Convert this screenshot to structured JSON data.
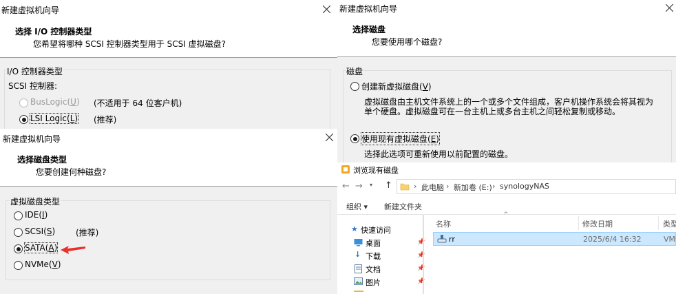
{
  "dialog_io": {
    "window_title": "新建虚拟机向导",
    "heading": "选择 I/O 控制器类型",
    "subheading": "您希望将哪种 SCSI 控制器类型用于 SCSI 虚拟磁盘?",
    "group_label": "I/O 控制器类型",
    "scsi_label": "SCSI 控制器:",
    "options": [
      {
        "label_pre": "BusLogic(",
        "key": "U",
        "label_post": ")",
        "note": "(不适用于 64 位客户机)",
        "checked": false,
        "disabled": true
      },
      {
        "label_pre": "LSI Logic(",
        "key": "L",
        "label_post": ")",
        "note": "(推荐)",
        "checked": true,
        "disabled": false
      }
    ]
  },
  "dialog_disk_type": {
    "window_title": "新建虚拟机向导",
    "heading": "选择磁盘类型",
    "subheading": "您要创建何种磁盘?",
    "group_label": "虚拟磁盘类型",
    "options": [
      {
        "label_pre": "IDE(",
        "key": "I",
        "label_post": ")",
        "note": "",
        "checked": false
      },
      {
        "label_pre": "SCSI(",
        "key": "S",
        "label_post": ")",
        "note": "(推荐)",
        "checked": false
      },
      {
        "label_pre": "SATA(",
        "key": "A",
        "label_post": ")",
        "note": "",
        "checked": true
      },
      {
        "label_pre": "NVMe(",
        "key": "V",
        "label_post": ")",
        "note": "",
        "checked": false
      }
    ],
    "arrow_color": "#e8302c"
  },
  "dialog_disk": {
    "window_title": "新建虚拟机向导",
    "heading": "选择磁盘",
    "subheading": "您要使用哪个磁盘?",
    "group_label": "磁盘",
    "opt_create": {
      "label_pre": "创建新虚拟磁盘(",
      "key": "V",
      "label_post": ")",
      "checked": false
    },
    "create_desc_1": "虚拟磁盘由主机文件系统上的一个或多个文件组成，客户机操作系统会将其视为",
    "create_desc_2": "单个硬盘。虚拟磁盘可在一台主机上或多台主机之间轻松复制或移动。",
    "opt_existing": {
      "label_pre": "使用现有虚拟磁盘(",
      "key": "E",
      "label_post": ")",
      "checked": true
    },
    "existing_desc": "选择此选项可重新使用以前配置的磁盘。"
  },
  "explorer": {
    "window_title": "浏览现有磁盘",
    "breadcrumb": [
      "此电脑",
      "新加卷 (E:)",
      "synologyNAS"
    ],
    "organize": "组织 ▾",
    "new_folder": "新建文件夹",
    "columns": [
      "名称",
      "修改日期",
      "类型"
    ],
    "nav": [
      {
        "label": "快速访问",
        "icon": "star-icon"
      },
      {
        "label": "桌面",
        "icon": "desktop-icon"
      },
      {
        "label": "下载",
        "icon": "download-icon"
      },
      {
        "label": "文档",
        "icon": "document-icon"
      },
      {
        "label": "图片",
        "icon": "picture-icon"
      }
    ],
    "files": [
      {
        "name": "rr",
        "date": "2025/6/4 16:32",
        "type": "VMware"
      }
    ],
    "accent": "#cce8ff"
  }
}
